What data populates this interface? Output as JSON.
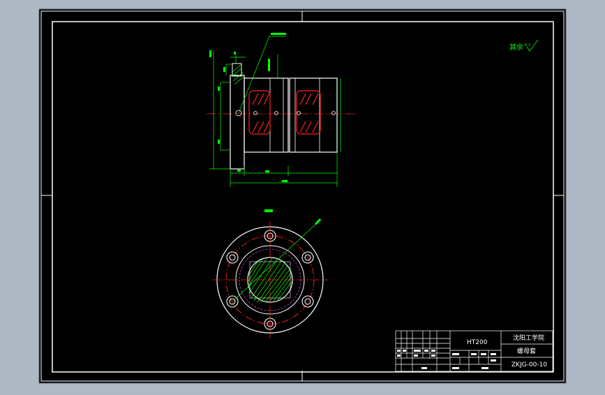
{
  "colors": {
    "background": "#aeb9c5",
    "paper": "#000000",
    "frame": "#ffffff",
    "centerline": "#ff2020",
    "dimension": "#00ff00",
    "hatch": "#00ff00",
    "bolt_circle": "#cc44cc"
  },
  "title_block": {
    "material": "HT200",
    "school": "沈阳工学院",
    "part_name": "螺母套",
    "drawing_no": "ZKJG-00-10"
  },
  "annotations": {
    "roughness_note": "其余",
    "roughness_value": "6.3"
  }
}
